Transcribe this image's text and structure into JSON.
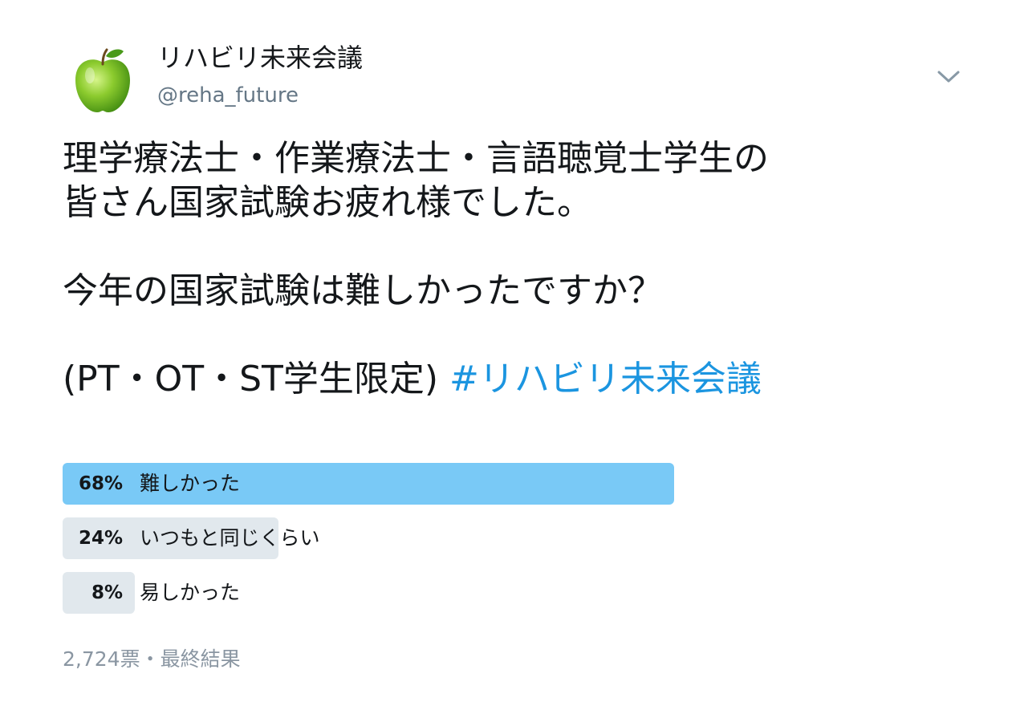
{
  "user": {
    "display_name": "リハビリ未来会議",
    "handle": "@reha_future",
    "avatar_icon": "green-apple-icon"
  },
  "menu_icon": "chevron-down-icon",
  "tweet": {
    "line1": "理学療法士・作業療法士・言語聴覚士学生の",
    "line2": "皆さん国家試験お疲れ様でした。",
    "line3": "今年の国家試験は難しかったですか？",
    "line4": "(PT・OT・ST学生限定) ",
    "hashtag": "#リハビリ未来会議"
  },
  "poll": {
    "choices": [
      {
        "percent_label": "68%",
        "label": "難しかった",
        "fraction": 0.68,
        "winner": true
      },
      {
        "percent_label": "24%",
        "label": "いつもと同じくらい",
        "fraction": 0.24,
        "winner": false
      },
      {
        "percent_label": "8%",
        "label": "易しかった",
        "fraction": 0.08,
        "winner": false
      }
    ],
    "votes": "2,724票",
    "separator": "・",
    "status": "最終結果"
  },
  "colors": {
    "accent": "#1b95e0",
    "winner_bar": "#79c9f6",
    "other_bar": "#e1e8ed",
    "muted_text": "#657786"
  }
}
